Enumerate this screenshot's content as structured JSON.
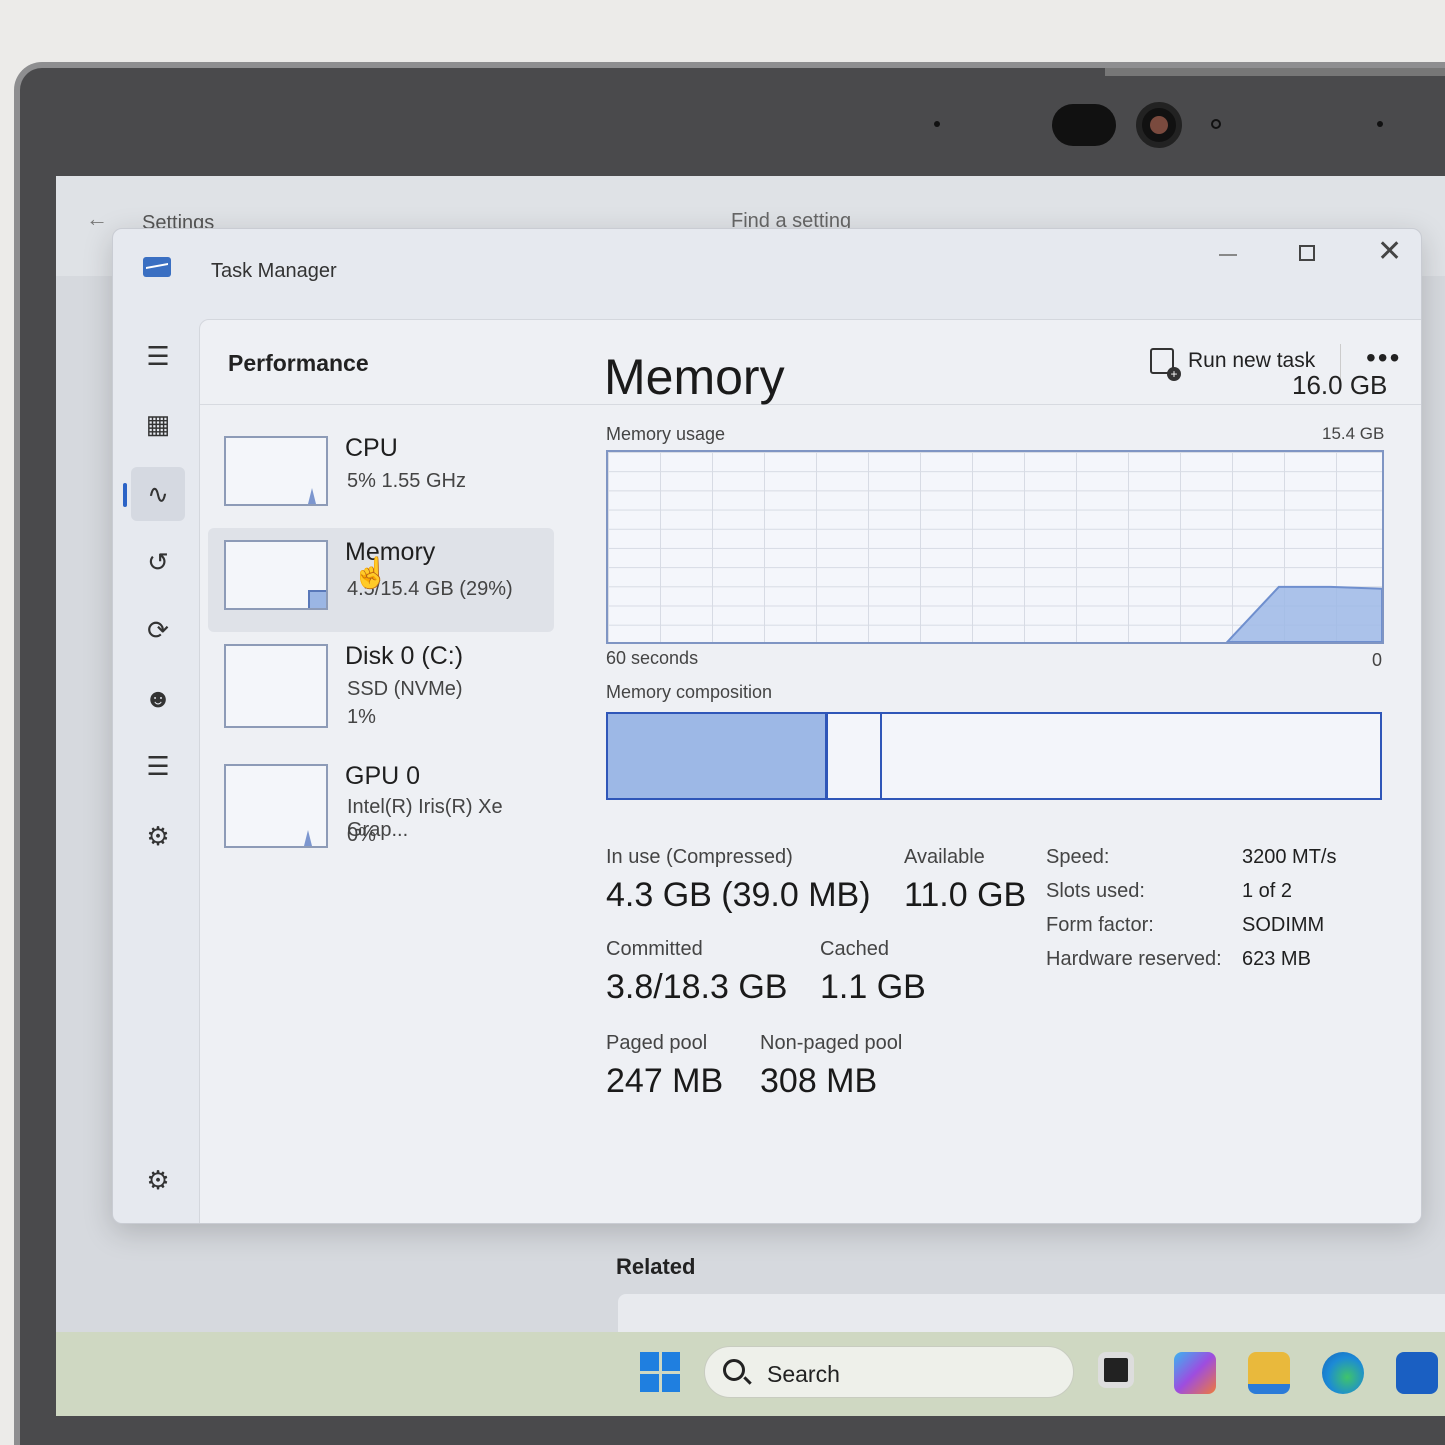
{
  "settings_bg": {
    "title": "Settings",
    "search_placeholder": "Find a setting",
    "related_label": "Related"
  },
  "taskbar": {
    "search_label": "Search"
  },
  "window": {
    "title": "Task Manager"
  },
  "header": {
    "title": "Performance",
    "run_new_task": "Run new task"
  },
  "devices": [
    {
      "name": "CPU",
      "line1": "5%  1.55 GHz",
      "line2": ""
    },
    {
      "name": "Memory",
      "line1": "4.5/15.4 GB (29%)",
      "line2": ""
    },
    {
      "name": "Disk 0 (C:)",
      "line1": "SSD (NVMe)",
      "line2": "1%"
    },
    {
      "name": "GPU 0",
      "line1": "Intel(R) Iris(R) Xe Grap...",
      "line2": "0%"
    }
  ],
  "memory": {
    "title": "Memory",
    "total": "16.0 GB",
    "usage_label": "Memory usage",
    "usage_max": "15.4 GB",
    "time_left": "60 seconds",
    "time_right": "0",
    "composition_label": "Memory composition",
    "usage_history_fraction": [
      0,
      0,
      0,
      0,
      0,
      0,
      0,
      0,
      0,
      0,
      0,
      0,
      0,
      0.29,
      0.29,
      0.28
    ],
    "stats": {
      "in_use_label": "In use (Compressed)",
      "in_use_value": "4.3 GB (39.0 MB)",
      "available_label": "Available",
      "available_value": "11.0 GB",
      "committed_label": "Committed",
      "committed_value": "3.8/18.3 GB",
      "cached_label": "Cached",
      "cached_value": "1.1 GB",
      "paged_label": "Paged pool",
      "paged_value": "247 MB",
      "nonpaged_label": "Non-paged pool",
      "nonpaged_value": "308 MB"
    },
    "specs": {
      "speed_label": "Speed:",
      "speed_value": "3200 MT/s",
      "slots_label": "Slots used:",
      "slots_value": "1 of 2",
      "form_label": "Form factor:",
      "form_value": "SODIMM",
      "reserved_label": "Hardware reserved:",
      "reserved_value": "623 MB"
    }
  },
  "colors": {
    "accent": "#2f56b8",
    "graph_fill": "#9db8e6"
  }
}
